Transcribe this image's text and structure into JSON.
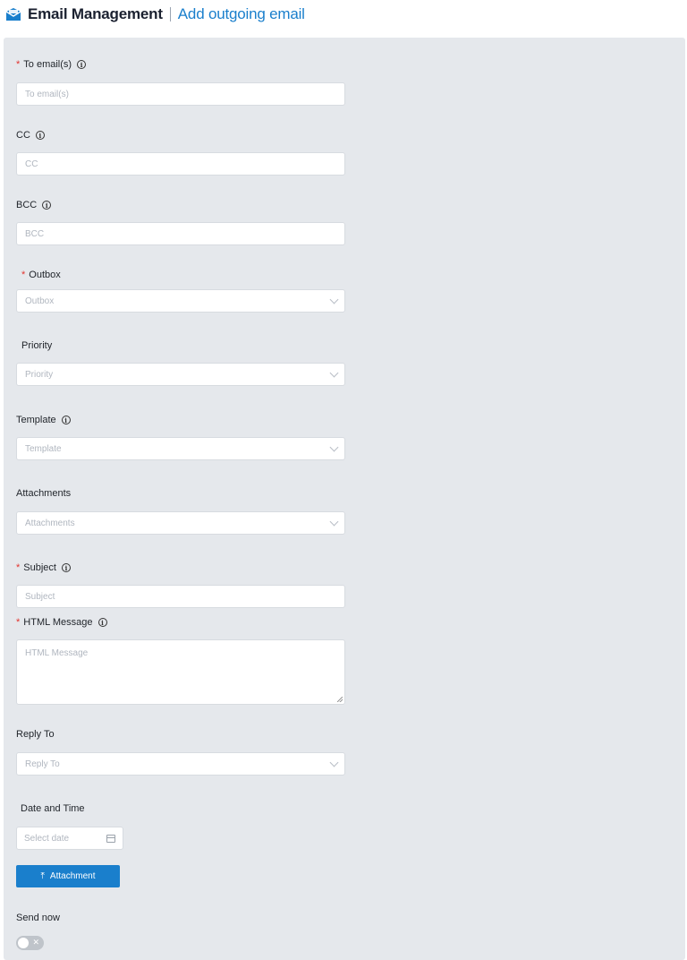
{
  "header": {
    "app_title": "Email Management",
    "page_title": "Add outgoing email",
    "brand_color": "#1a7fcc"
  },
  "form": {
    "to": {
      "label": "To email(s)",
      "placeholder": "To email(s)",
      "required": true
    },
    "cc": {
      "label": "CC",
      "placeholder": "CC"
    },
    "bcc": {
      "label": "BCC",
      "placeholder": "BCC"
    },
    "outbox": {
      "label": "Outbox",
      "placeholder": "Outbox",
      "required": true
    },
    "priority": {
      "label": "Priority",
      "placeholder": "Priority"
    },
    "template": {
      "label": "Template",
      "placeholder": "Template"
    },
    "attachments": {
      "label": "Attachments",
      "placeholder": "Attachments"
    },
    "subject": {
      "label": "Subject",
      "placeholder": "Subject",
      "required": true
    },
    "html_message": {
      "label": "HTML Message",
      "placeholder": "HTML Message",
      "required": true
    },
    "reply_to": {
      "label": "Reply To",
      "placeholder": "Reply To"
    },
    "date_time": {
      "label": "Date and Time",
      "placeholder": "Select date"
    },
    "attachment_button": {
      "label": "Attachment"
    },
    "send_now": {
      "label": "Send now",
      "toggle_off_glyph": "✕"
    }
  },
  "icons": {
    "info": "i",
    "upload": "⤒",
    "required_mark": "*"
  }
}
